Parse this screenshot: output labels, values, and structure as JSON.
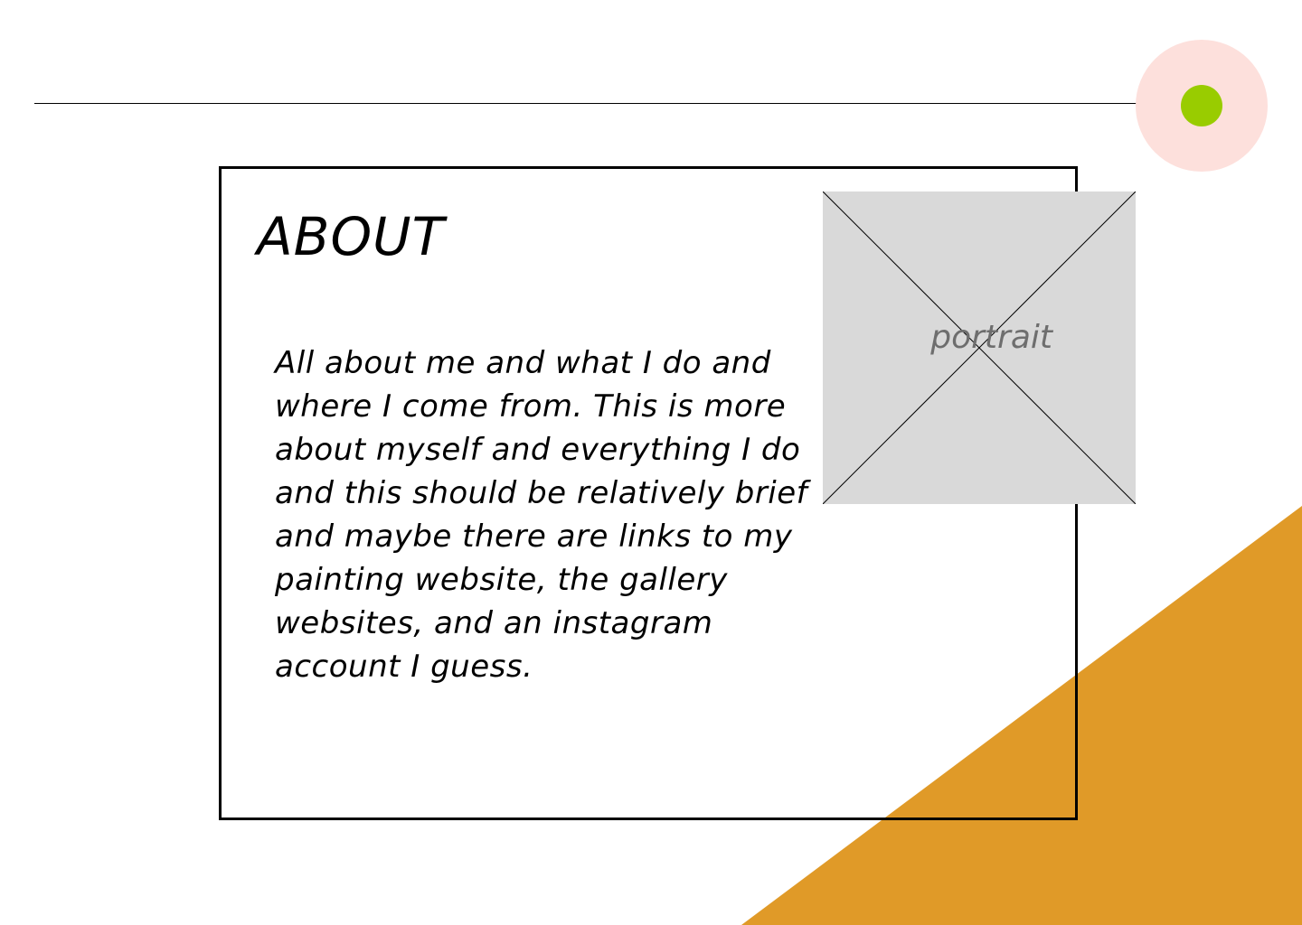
{
  "about": {
    "title": "ABOUT",
    "body": "All about me and what I do and where I come from. This is more about myself and everything I do and this should be relatively brief and maybe there are links to my painting website, the gallery websites, and an instagram account I guess."
  },
  "portrait": {
    "label": "portrait"
  },
  "colors": {
    "accent_orange": "#e09a28",
    "nav_circle": "#fde0dc",
    "nav_dot": "#99cc00",
    "placeholder_gray": "#d9d9d9"
  }
}
